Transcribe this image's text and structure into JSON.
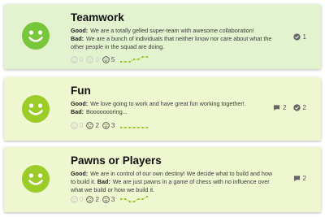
{
  "cards": [
    {
      "title": "Teamwork",
      "good_label": "Good:",
      "good_text": "We are a totally gelled super-team with awesome collaboration!",
      "bad_label": "Bad:",
      "bad_text": "We are a bunch of individuals that neither know nor care about what the other people in the squad are doing.",
      "votes": {
        "sad": "0",
        "neutral": "0",
        "happy": "5"
      },
      "comments": "",
      "checks": "1",
      "background": "#e3f3cf",
      "face_color": "#78c73a",
      "trend": [
        1,
        1,
        1,
        2,
        2,
        3,
        3
      ]
    },
    {
      "title": "Fun",
      "good_label": "Good:",
      "good_text": "We love going to work and have great fun working together!.",
      "bad_label": "Bad:",
      "bad_text": "Boooooooring...",
      "votes": {
        "sad": "0",
        "neutral": "2",
        "happy": "3"
      },
      "comments": "2",
      "checks": "2",
      "background": "#eef7cf",
      "face_color": "#9bcc27",
      "trend": [
        1,
        1,
        1,
        1,
        1,
        1,
        1
      ]
    },
    {
      "title": "Pawns or Players",
      "good_label": "Good:",
      "good_text": "We are in control of our own destiny! We decide what to build and how to build it.",
      "bad_label": "Bad:",
      "bad_text": "We are just pawns in a game of chess with no influence over what we build or how we build it.",
      "votes": {
        "sad": "0",
        "neutral": "2",
        "happy": "3"
      },
      "comments": "2",
      "checks": "",
      "background": "#eef7cf",
      "face_color": "#9bcc27",
      "trend": [
        2,
        2,
        1,
        1,
        2,
        2,
        3
      ]
    }
  ],
  "icons": {
    "face": "happy-face-icon",
    "sad": "sad-face-icon",
    "neutral": "neutral-face-icon",
    "happy": "happy-small-icon",
    "comment": "comment-icon",
    "check": "check-circle-icon",
    "trend": "trend-sparkline-icon"
  },
  "colors": {
    "spark_line": "#c9dc4e",
    "spark_dot": "#7fbf2a",
    "icon_gray": "#666666"
  }
}
